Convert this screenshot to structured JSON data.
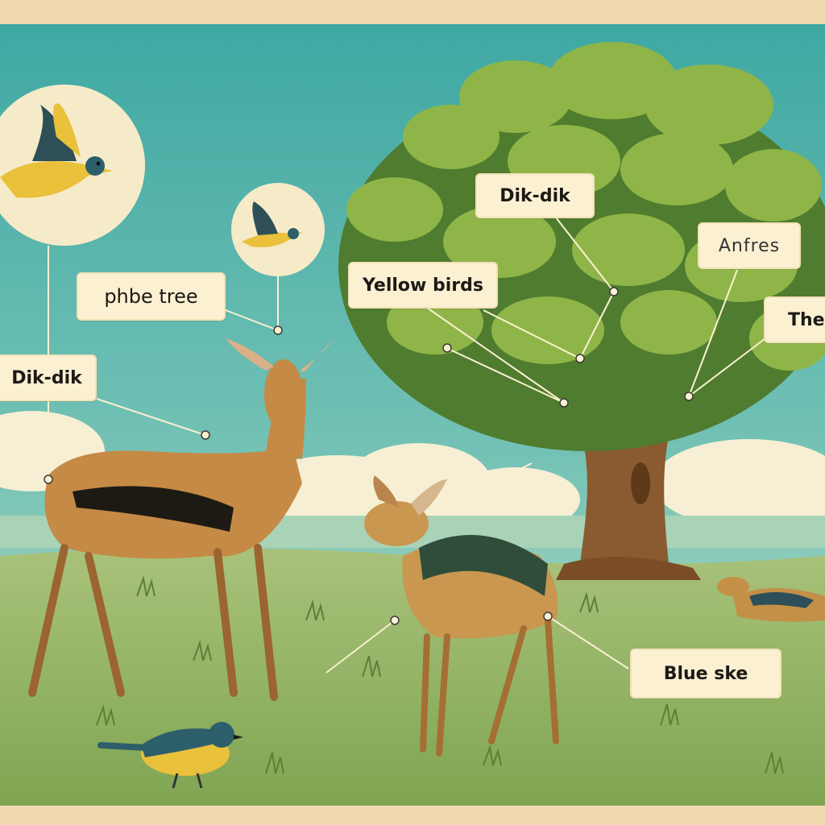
{
  "labels": {
    "phbe_tree": "phbe tree",
    "dik_dik_left": "Dik-dik",
    "yellow_birds": "Yellow birds",
    "dik_dik_tree": "Dik-dik",
    "anfres": "Anfres",
    "the_partial": "The",
    "blue_ske": "Blue ske"
  },
  "colors": {
    "frame": "#f1d9b0",
    "sky": "#4fb0a6",
    "grass": "#9cbb6a",
    "foliage": "#6f9a3a",
    "label_bg": "#fbf0d2",
    "dikdik_body": "#c58a45",
    "bird_yellow": "#e9c13b",
    "bird_blue": "#2d5f6b"
  },
  "icons": [
    "flying-yellow-bird-icon",
    "small-flying-bird-icon",
    "ground-bird-icon"
  ]
}
